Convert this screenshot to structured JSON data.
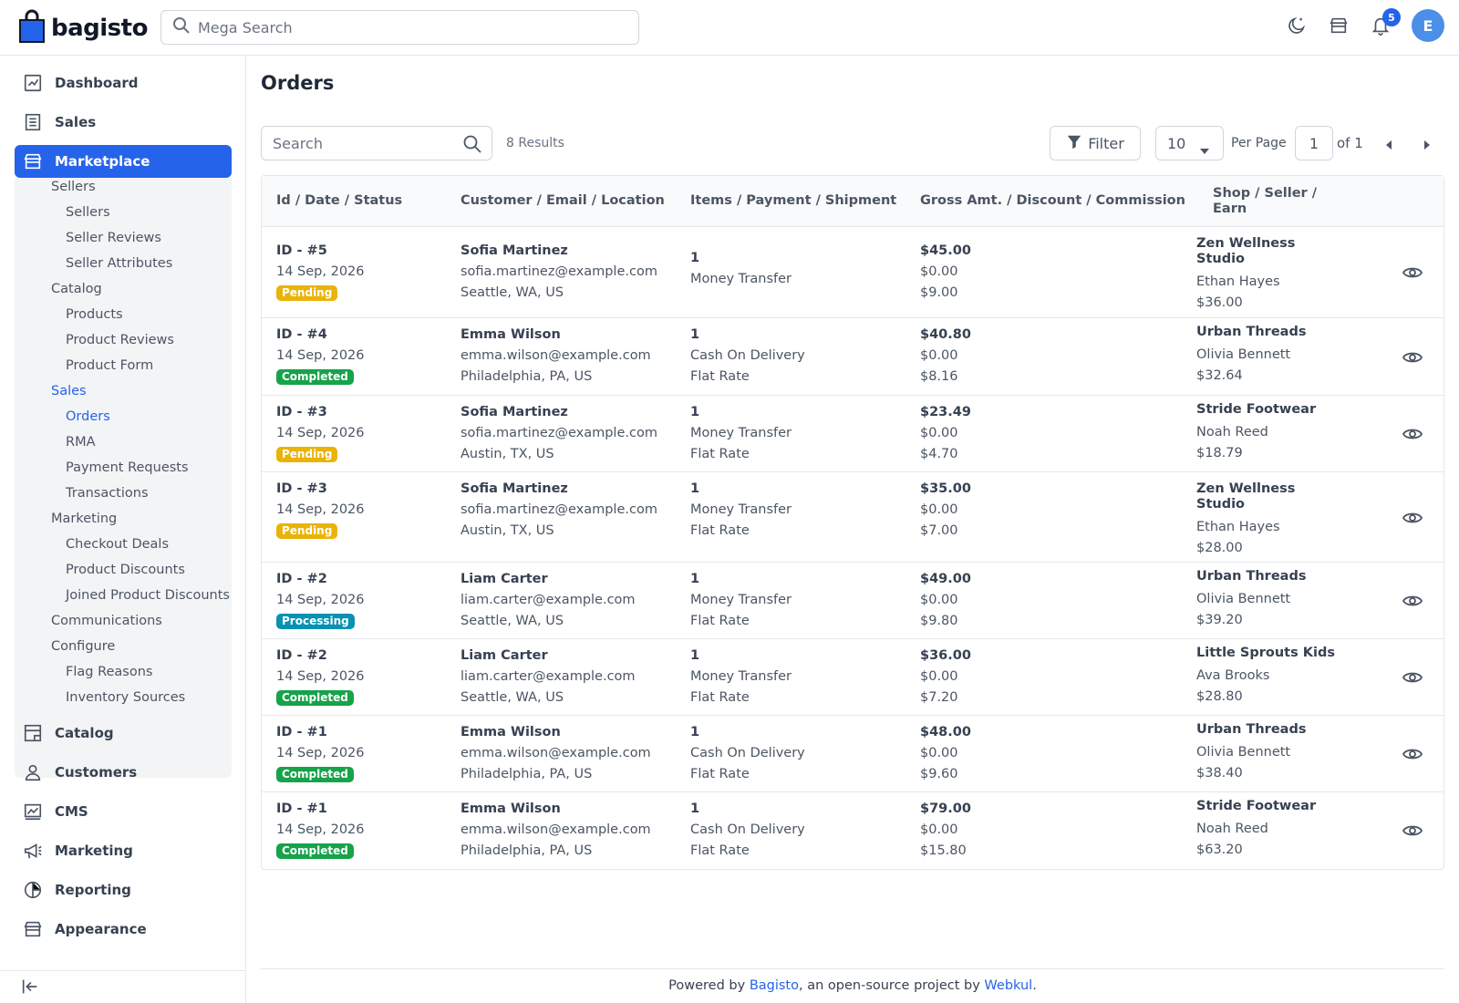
{
  "app": {
    "logo_text": "bagisto"
  },
  "topbar": {
    "search_placeholder": "Mega Search",
    "notification_count": "5",
    "avatar_initial": "E"
  },
  "sidebar": {
    "items": [
      {
        "label": "Dashboard",
        "icon": "dashboard-icon"
      },
      {
        "label": "Sales",
        "icon": "sales-icon"
      },
      {
        "label": "Marketplace",
        "icon": "marketplace-icon",
        "active": true
      },
      {
        "label": "Catalog",
        "icon": "catalog-icon"
      },
      {
        "label": "Customers",
        "icon": "customers-icon"
      },
      {
        "label": "CMS",
        "icon": "cms-icon"
      },
      {
        "label": "Marketing",
        "icon": "marketing-icon"
      },
      {
        "label": "Reporting",
        "icon": "reporting-icon"
      },
      {
        "label": "Appearance",
        "icon": "appearance-icon"
      }
    ],
    "marketplace_submenu": {
      "sellers": "Sellers",
      "sellers_items": [
        "Sellers",
        "Seller Reviews",
        "Seller Attributes"
      ],
      "catalog": "Catalog",
      "catalog_items": [
        "Products",
        "Product Reviews",
        "Product Form"
      ],
      "sales": "Sales",
      "sales_items": [
        "Orders",
        "RMA",
        "Payment Requests",
        "Transactions"
      ],
      "marketing": "Marketing",
      "marketing_items": [
        "Checkout Deals",
        "Product Discounts",
        "Joined Product Discounts"
      ],
      "communications": "Communications",
      "configure": "Configure",
      "configure_items": [
        "Flag Reasons",
        "Inventory Sources"
      ]
    }
  },
  "main": {
    "title": "Orders",
    "search_placeholder": "Search",
    "results_text": "8 Results",
    "filter_label": "Filter",
    "per_page_value": "10",
    "per_page_label": "Per Page",
    "page_number": "1",
    "of_label": "of 1"
  },
  "table": {
    "columns": [
      "Id / Date / Status",
      "Customer / Email / Location",
      "Items / Payment / Shipment",
      "Gross Amt. / Discount / Commission",
      "Shop / Seller / Earn"
    ],
    "rows": [
      {
        "id": "ID - #5",
        "date": "14 Sep, 2026",
        "status": "Pending",
        "customer": "Sofia Martinez",
        "email": "sofia.martinez@example.com",
        "location": "Seattle, WA, US",
        "items": "1",
        "payment": "Money Transfer",
        "shipment": "",
        "gross": "$45.00",
        "discount": "$0.00",
        "commission": "$9.00",
        "shop": "Zen Wellness Studio",
        "seller": "Ethan Hayes",
        "earn": "$36.00"
      },
      {
        "id": "ID - #4",
        "date": "14 Sep, 2026",
        "status": "Completed",
        "customer": "Emma Wilson",
        "email": "emma.wilson@example.com",
        "location": "Philadelphia, PA, US",
        "items": "1",
        "payment": "Cash On Delivery",
        "shipment": "Flat Rate",
        "gross": "$40.80",
        "discount": "$0.00",
        "commission": "$8.16",
        "shop": "Urban Threads",
        "seller": "Olivia Bennett",
        "earn": "$32.64"
      },
      {
        "id": "ID - #3",
        "date": "14 Sep, 2026",
        "status": "Pending",
        "customer": "Sofia Martinez",
        "email": "sofia.martinez@example.com",
        "location": "Austin, TX, US",
        "items": "1",
        "payment": "Money Transfer",
        "shipment": "Flat Rate",
        "gross": "$23.49",
        "discount": "$0.00",
        "commission": "$4.70",
        "shop": "Stride Footwear",
        "seller": "Noah Reed",
        "earn": "$18.79"
      },
      {
        "id": "ID - #3",
        "date": "14 Sep, 2026",
        "status": "Pending",
        "customer": "Sofia Martinez",
        "email": "sofia.martinez@example.com",
        "location": "Austin, TX, US",
        "items": "1",
        "payment": "Money Transfer",
        "shipment": "Flat Rate",
        "gross": "$35.00",
        "discount": "$0.00",
        "commission": "$7.00",
        "shop": "Zen Wellness Studio",
        "seller": "Ethan Hayes",
        "earn": "$28.00"
      },
      {
        "id": "ID - #2",
        "date": "14 Sep, 2026",
        "status": "Processing",
        "customer": "Liam Carter",
        "email": "liam.carter@example.com",
        "location": "Seattle, WA, US",
        "items": "1",
        "payment": "Money Transfer",
        "shipment": "Flat Rate",
        "gross": "$49.00",
        "discount": "$0.00",
        "commission": "$9.80",
        "shop": "Urban Threads",
        "seller": "Olivia Bennett",
        "earn": "$39.20"
      },
      {
        "id": "ID - #2",
        "date": "14 Sep, 2026",
        "status": "Completed",
        "customer": "Liam Carter",
        "email": "liam.carter@example.com",
        "location": "Seattle, WA, US",
        "items": "1",
        "payment": "Money Transfer",
        "shipment": "Flat Rate",
        "gross": "$36.00",
        "discount": "$0.00",
        "commission": "$7.20",
        "shop": "Little Sprouts Kids",
        "seller": "Ava Brooks",
        "earn": "$28.80"
      },
      {
        "id": "ID - #1",
        "date": "14 Sep, 2026",
        "status": "Completed",
        "customer": "Emma Wilson",
        "email": "emma.wilson@example.com",
        "location": "Philadelphia, PA, US",
        "items": "1",
        "payment": "Cash On Delivery",
        "shipment": "Flat Rate",
        "gross": "$48.00",
        "discount": "$0.00",
        "commission": "$9.60",
        "shop": "Urban Threads",
        "seller": "Olivia Bennett",
        "earn": "$38.40"
      },
      {
        "id": "ID - #1",
        "date": "14 Sep, 2026",
        "status": "Completed",
        "customer": "Emma Wilson",
        "email": "emma.wilson@example.com",
        "location": "Philadelphia, PA, US",
        "items": "1",
        "payment": "Cash On Delivery",
        "shipment": "Flat Rate",
        "gross": "$79.00",
        "discount": "$0.00",
        "commission": "$15.80",
        "shop": "Stride Footwear",
        "seller": "Noah Reed",
        "earn": "$63.20"
      }
    ]
  },
  "status_colors": {
    "Pending": "#eab308",
    "Completed": "#16a34a",
    "Processing": "#0891b2"
  },
  "footer": {
    "prefix": "Powered by ",
    "link1": "Bagisto",
    "middle": ", an open-source project by ",
    "link2": "Webkul",
    "suffix": "."
  }
}
